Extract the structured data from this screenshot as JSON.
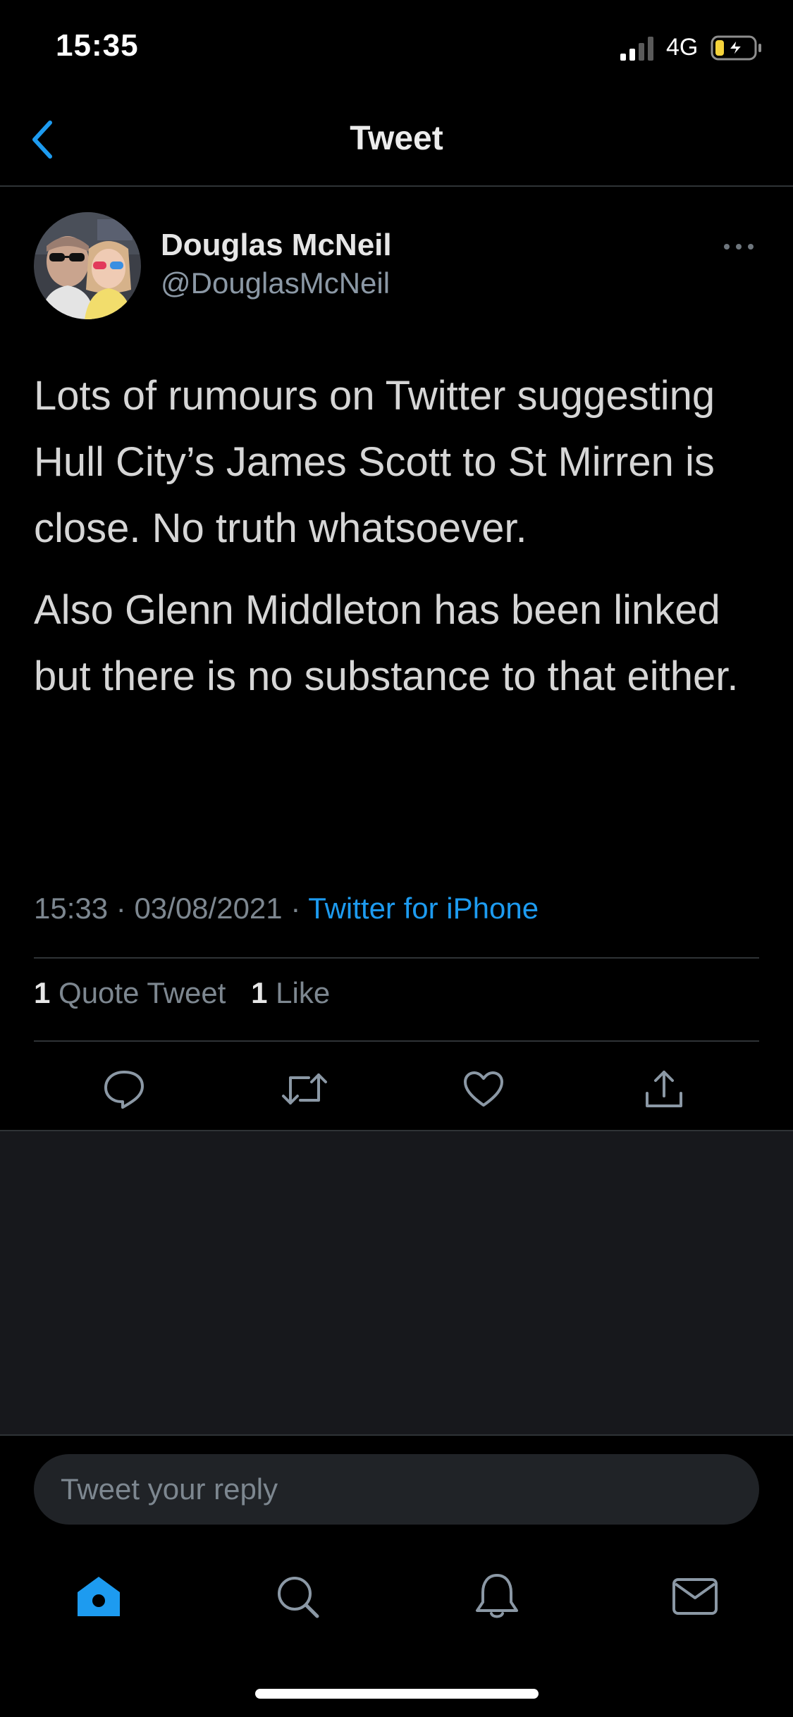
{
  "status_bar": {
    "time": "15:35",
    "network": "4G"
  },
  "header": {
    "title": "Tweet"
  },
  "tweet": {
    "author_name": "Douglas McNeil",
    "author_handle": "@DouglasMcNeil",
    "paragraphs": [
      "Lots of rumours on Twitter suggesting Hull City’s James Scott to St Mirren is close. No truth whatsoever.",
      "Also Glenn Middleton has been linked but there is no substance to that either."
    ],
    "time": "15:33",
    "date": "03/08/2021",
    "source": "Twitter for iPhone",
    "quote_tweet_count": "1",
    "quote_tweet_label": "Quote Tweet",
    "like_count": "1",
    "like_label": "Like"
  },
  "reply": {
    "placeholder": "Tweet your reply"
  },
  "colors": {
    "accent": "#1d9bf0",
    "background": "#000000",
    "secondary_background": "#17181c",
    "muted_text": "#7d8790",
    "battery_charging": "#f5d33b"
  },
  "icons": {
    "back": "chevron-left-icon",
    "more": "more-horizontal-icon",
    "reply": "reply-icon",
    "retweet": "retweet-icon",
    "like": "heart-icon",
    "share": "share-icon",
    "home": "home-icon",
    "search": "search-icon",
    "notifications": "bell-icon",
    "messages": "mail-icon"
  },
  "tab_bar": {
    "active": "home"
  }
}
